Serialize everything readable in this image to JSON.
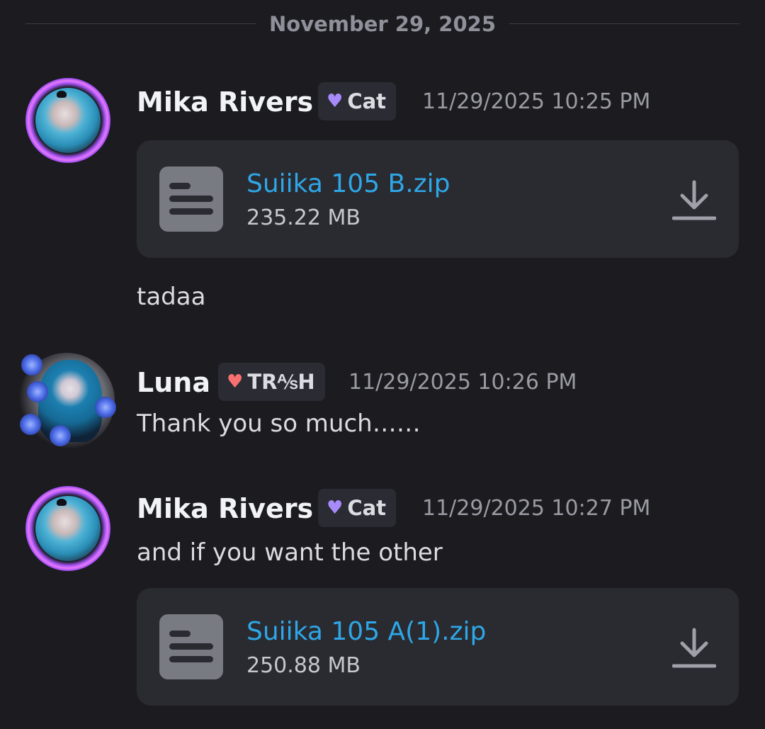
{
  "date_divider": "November 29, 2025",
  "messages": [
    {
      "author": "Mika Rivers",
      "tag": "Cat",
      "tag_heart_color": "#a78bfa",
      "timestamp": "11/29/2025 10:25 PM",
      "attachment": {
        "filename": "Suiika 105 B.zip",
        "size": "235.22 MB",
        "icon": "file-icon"
      },
      "text": "tadaa"
    },
    {
      "author": "Luna",
      "tag": "TR⅍H",
      "tag_heart_color": "#f87171",
      "timestamp": "11/29/2025 10:26 PM",
      "text": "Thank you so much……"
    },
    {
      "author": "Mika Rivers",
      "tag": "Cat",
      "tag_heart_color": "#a78bfa",
      "timestamp": "11/29/2025 10:27 PM",
      "text": "and if you want the other",
      "attachment": {
        "filename": "Suiika 105 A(1).zip",
        "size": "250.88 MB",
        "icon": "file-icon"
      }
    }
  ],
  "colors": {
    "background": "#1b1b20",
    "attachment_bg": "#2a2a31",
    "link": "#2ea7e6"
  }
}
